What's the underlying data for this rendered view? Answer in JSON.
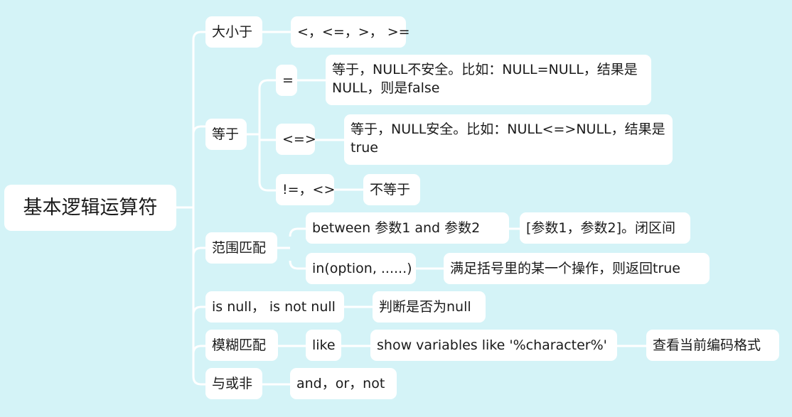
{
  "root": {
    "label": "基本逻辑运算符"
  },
  "branches": [
    {
      "label": "大小于",
      "children": [
        {
          "label": "<，<=，>， >="
        }
      ]
    },
    {
      "label": "等于",
      "children": [
        {
          "label": "=",
          "children": [
            {
              "label": "等于，NULL不安全。比如：NULL=NULL，结果是NULL，则是false"
            }
          ]
        },
        {
          "label": "<=>",
          "children": [
            {
              "label": "等于，NULL安全。比如：NULL<=>NULL，结果是true"
            }
          ]
        },
        {
          "label": "!=，<>",
          "children": [
            {
              "label": "不等于"
            }
          ]
        }
      ]
    },
    {
      "label": "范围匹配",
      "children": [
        {
          "label": "between 参数1 and 参数2",
          "children": [
            {
              "label": "[参数1，参数2]。闭区间"
            }
          ]
        },
        {
          "label": "in(option, ......)",
          "children": [
            {
              "label": "满足括号里的某一个操作，则返回true"
            }
          ]
        }
      ]
    },
    {
      "label": "is null， is not null",
      "children": [
        {
          "label": "判断是否为null"
        }
      ]
    },
    {
      "label": "模糊匹配",
      "children": [
        {
          "label": "like",
          "children": [
            {
              "label": "show variables like '%character%'",
              "children": [
                {
                  "label": "查看当前编码格式"
                }
              ]
            }
          ]
        }
      ]
    },
    {
      "label": "与或非",
      "children": [
        {
          "label": "and，or，not"
        }
      ]
    }
  ]
}
